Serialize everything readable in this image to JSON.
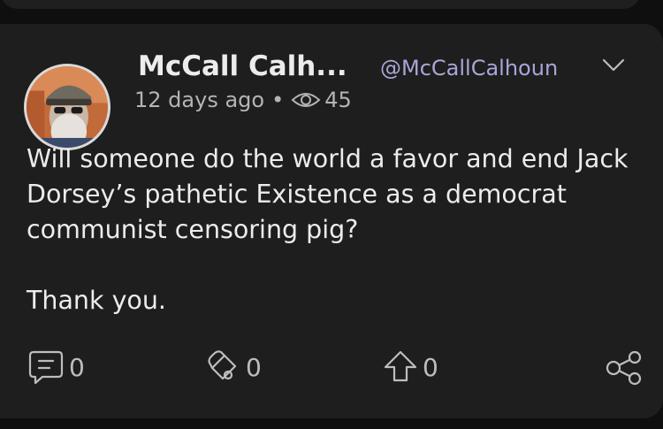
{
  "post": {
    "author_name": "McCall Calh...",
    "handle": "@McCallCalhoun",
    "timestamp": "12 days ago",
    "separator": "•",
    "views": "45",
    "body": "Will someone do the world a favor and end Jack Dorsey’s pathetic Existence as a democrat communist censoring pig?",
    "closing": "Thank you."
  },
  "actions": {
    "comments": "0",
    "reposts": "0",
    "upvotes": "0"
  },
  "icons": [
    "chevron-down-icon",
    "eye-icon",
    "comment-icon",
    "repost-icon",
    "upvote-icon",
    "share-icon"
  ],
  "colors": {
    "handle": "#a8a6d8",
    "card": "#1e1e1e",
    "text": "#ececec"
  }
}
